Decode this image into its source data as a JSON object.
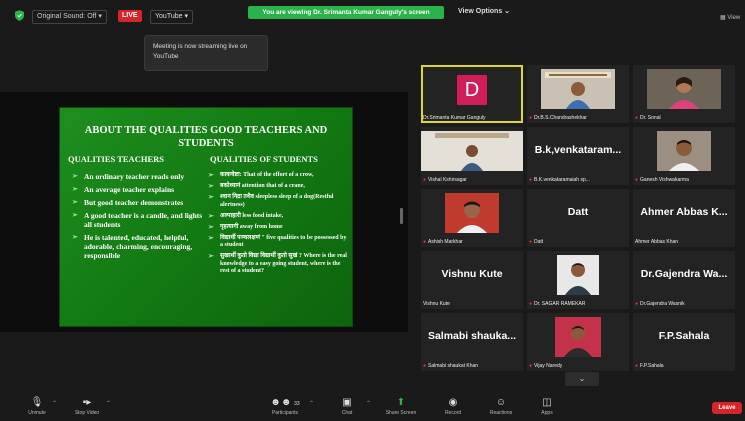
{
  "topbar": {
    "original_sound": "Original Sound: Off",
    "live_badge": "LIVE",
    "youtube_dropdown": "YouTube",
    "viewing_banner": "You are viewing Dr. Srimanta Kumar Ganguly's screen",
    "view_options": "View Options",
    "view_button": "View"
  },
  "tooltip": "Meeting is now streaming live on YouTube",
  "slide": {
    "title": "ABOUT THE QUALITIES GOOD TEACHERS AND STUDENTS",
    "teachers_heading": "QUALITIES TEACHERS",
    "students_heading": "QUALITIES OF STUDENTS",
    "teacher_points": [
      "An ordinary teacher reads only",
      "An average teacher explains",
      "But good teacher demonstrates",
      "A good teacher is a candle, and lights all students",
      "He is talented, educated, helpful, adorable, charming, encouraging, responsible"
    ],
    "student_points": [
      "काकचेष्टा: That of the effort of a crow,",
      "बकोध्यानं attention that of a crane,",
      "श्वान निद्रा तथैव sleepless sleep of a dog(Restful alertness)",
      "अल्पाहारी less food intake,",
      "गृहत्यागी away from home",
      "विद्यार्थी पञ्चलक्षणं \" five qualities to be possessed by a student",
      "सुखार्थी कुतो विद्या विद्यार्थी कुतो सुखं ? Where is the real knowledge to a easy going student, where is the rest of a student?"
    ]
  },
  "participants": {
    "dr_srimanta": {
      "initial": "D",
      "name": "Dr.Srimanta Kumar Ganguly"
    },
    "dr_chandrashekhar": {
      "name": "Dr.B.S.Chandrashekhar"
    },
    "dr_sonal": {
      "name": "Dr. Sonal"
    },
    "vishal": {
      "name": "Vishal Kshirsagar"
    },
    "venkataram": {
      "display": "B.k,venkataram...",
      "name": "B.K.venkataramaiah sp..."
    },
    "ganesh": {
      "name": "Ganesh Vishwakarma"
    },
    "ashish": {
      "name": "Ashish Markhar"
    },
    "datt": {
      "display": "Datt",
      "name": "Datt"
    },
    "ahmer": {
      "display": "Ahmer Abbas K...",
      "name": "Ahmer Abbas Khan"
    },
    "vishnu": {
      "display": "Vishnu Kute",
      "name": "Vishnu Kute"
    },
    "sagar": {
      "name": "Dr. SAGAR RAMEKAR"
    },
    "gajendra": {
      "display": "Dr.Gajendra Wa...",
      "name": "Dr.Gajendra Wasnik"
    },
    "salmabi": {
      "display": "Salmabi shauka...",
      "name": "Salmabi shaukat Khan"
    },
    "vijay": {
      "name": "Vijay Naredy"
    },
    "sahala": {
      "display": "F.P.Sahala",
      "name": "F.P.Sahala"
    }
  },
  "bottombar": {
    "unmute": "Unmute",
    "stop_video": "Stop Video",
    "participants": "Participants",
    "participants_count": "33",
    "chat": "Chat",
    "share_screen": "Share Screen",
    "record": "Record",
    "reactions": "Reactions",
    "apps": "Apps",
    "leave": "Leave"
  },
  "colors": {
    "live": "#d8232a",
    "banner": "#2ab24b",
    "active_speaker_border": "#d9d92f",
    "avatar_d": "#d01d5c",
    "slide_bg": "#1a8a1a",
    "share_screen_icon": "#2ab24b"
  }
}
